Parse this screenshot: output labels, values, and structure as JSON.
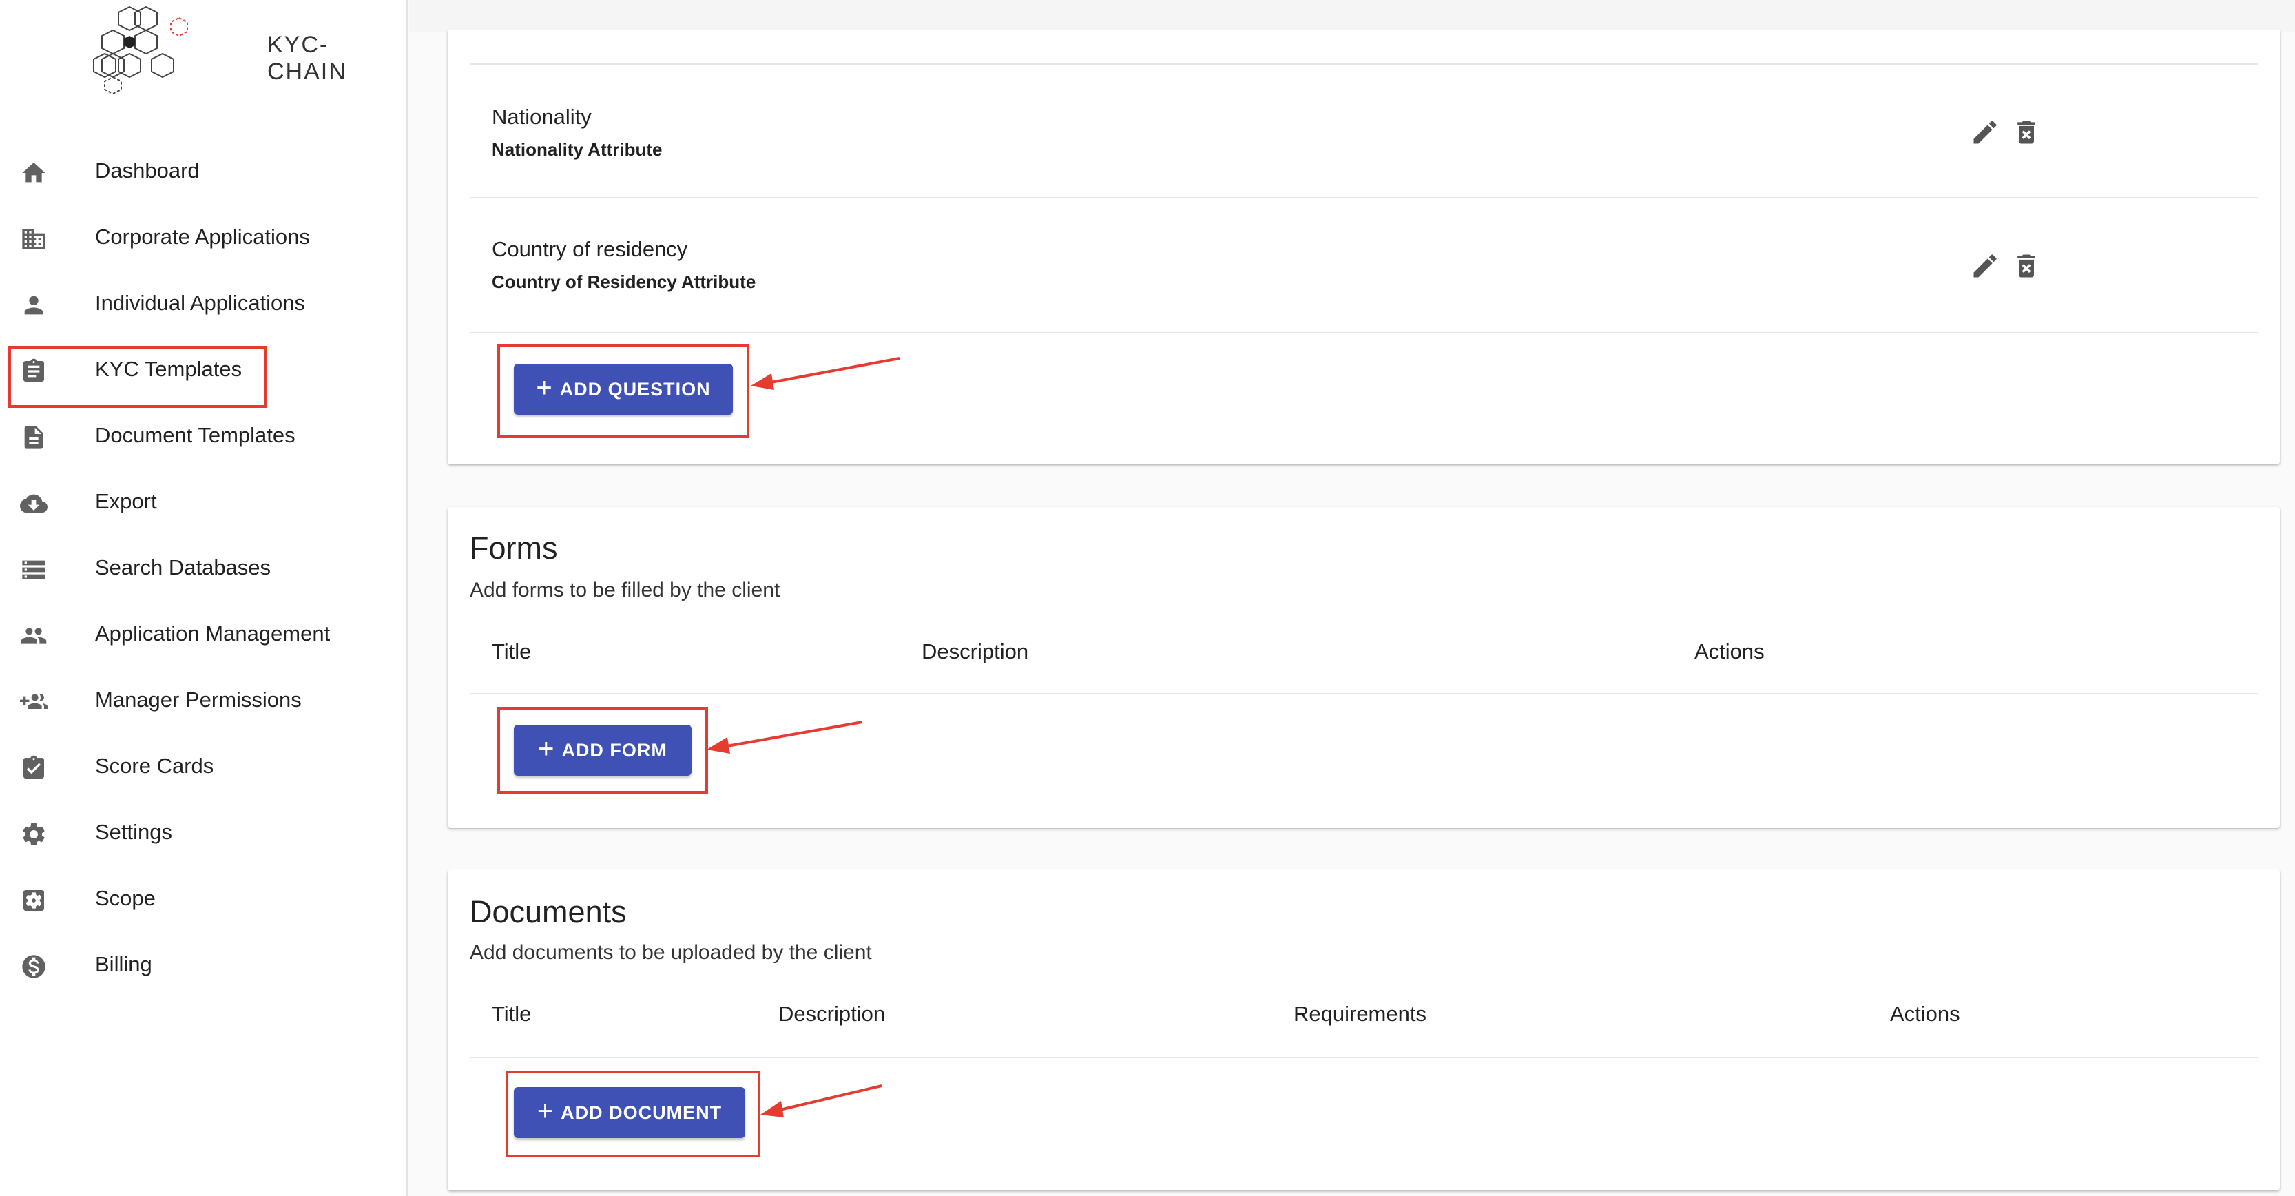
{
  "brand": {
    "name": "KYC-CHAIN"
  },
  "colors": {
    "accent": "#3f51b5",
    "highlight": "#e53b30",
    "icon": "#616161"
  },
  "sidebar": {
    "items": [
      {
        "label": "Dashboard",
        "icon": "home-icon"
      },
      {
        "label": "Corporate Applications",
        "icon": "building-icon"
      },
      {
        "label": "Individual Applications",
        "icon": "person-icon"
      },
      {
        "label": "KYC Templates",
        "icon": "clipboard-icon",
        "active": true
      },
      {
        "label": "Document Templates",
        "icon": "document-icon"
      },
      {
        "label": "Export",
        "icon": "cloud-download-icon"
      },
      {
        "label": "Search Databases",
        "icon": "storage-icon"
      },
      {
        "label": "Application Management",
        "icon": "people-icon"
      },
      {
        "label": "Manager Permissions",
        "icon": "group-add-icon"
      },
      {
        "label": "Score Cards",
        "icon": "assignment-check-icon"
      },
      {
        "label": "Settings",
        "icon": "gear-icon"
      },
      {
        "label": "Scope",
        "icon": "settings-box-icon"
      },
      {
        "label": "Billing",
        "icon": "dollar-icon"
      }
    ]
  },
  "questions": {
    "items": [
      {
        "title": "Nationality",
        "attribute": "Nationality Attribute"
      },
      {
        "title": "Country of residency",
        "attribute": "Country of Residency Attribute"
      }
    ],
    "add_label": "ADD QUESTION"
  },
  "forms": {
    "title": "Forms",
    "description": "Add forms to be filled by the client",
    "columns": [
      "Title",
      "Description",
      "Actions"
    ],
    "add_label": "ADD FORM"
  },
  "documents": {
    "title": "Documents",
    "description": "Add documents to be uploaded by the client",
    "columns": [
      "Title",
      "Description",
      "Requirements",
      "Actions"
    ],
    "add_label": "ADD DOCUMENT"
  }
}
